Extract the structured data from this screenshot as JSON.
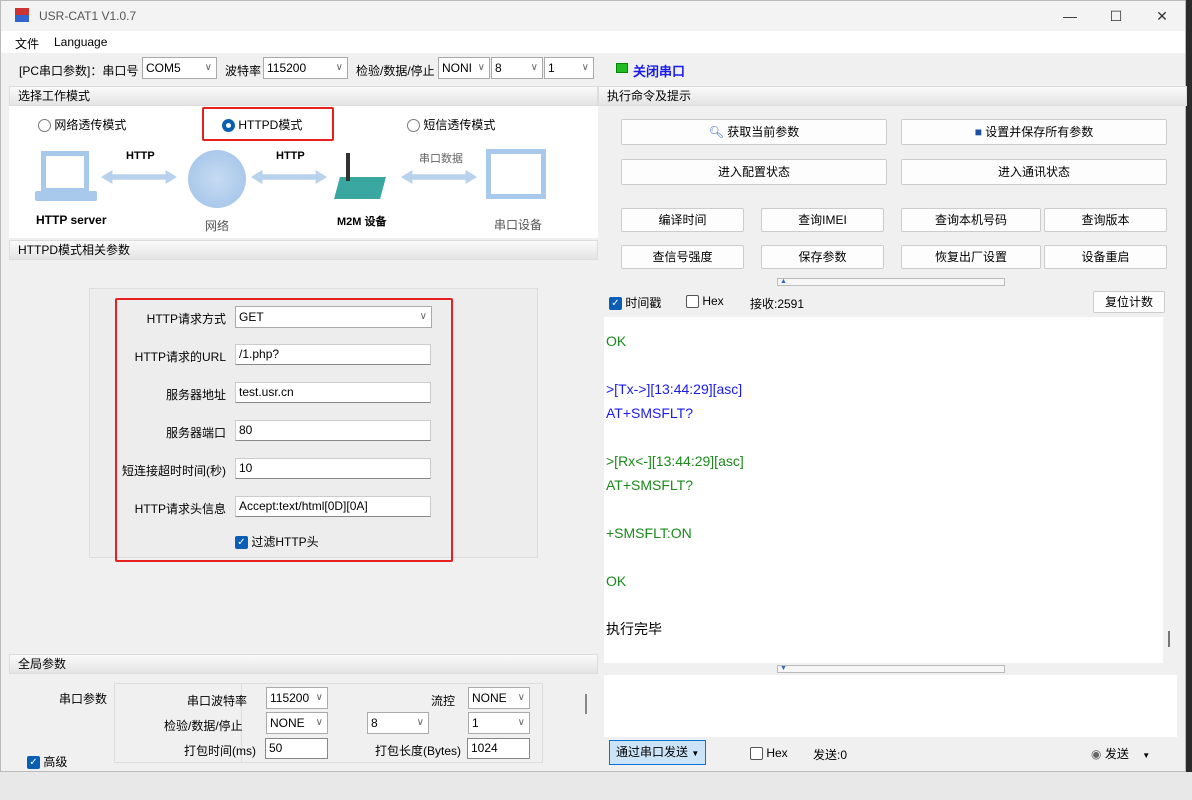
{
  "window": {
    "title": "USR-CAT1 V1.0.7",
    "min": "—",
    "max": "☐",
    "close": "✕"
  },
  "menu": [
    "文件",
    "Language"
  ],
  "toolbar": {
    "label": "[PC串口参数]：串口号",
    "port": "COM5",
    "baud_label": "波特率",
    "baud": "115200",
    "parity_label": "检验/数据/停止",
    "parity": "NONI",
    "data": "8",
    "stop": "1",
    "close_port": "关闭串口",
    "status_color": "#22bb22"
  },
  "mode": {
    "header": "选择工作模式",
    "options": [
      "网络透传模式",
      "HTTPD模式",
      "短信透传模式"
    ],
    "selected": 1,
    "diagram": {
      "http1": "HTTP",
      "http2": "HTTP",
      "serial_data": "串口数据",
      "server": "HTTP server",
      "network": "网络",
      "m2m": "M2M 设备",
      "serial_device": "串口设备"
    }
  },
  "httpd": {
    "header": "HTTPD模式相关参数",
    "fields": [
      {
        "label": "HTTP请求方式",
        "value": "GET",
        "type": "select"
      },
      {
        "label": "HTTP请求的URL",
        "value": "/1.php?"
      },
      {
        "label": "服务器地址",
        "value": "test.usr.cn"
      },
      {
        "label": "服务器端口",
        "value": "80"
      },
      {
        "label": "短连接超时时间(秒)",
        "value": "10"
      },
      {
        "label": "HTTP请求头信息",
        "value": "Accept:text/html[0D][0A]"
      }
    ],
    "filter_label": "过滤HTTP头",
    "filter_checked": true
  },
  "global": {
    "header": "全局参数",
    "serial_label": "串口参数",
    "baud_label": "串口波特率",
    "baud": "115200",
    "flow_label": "流控",
    "flow": "NONE",
    "parity_label": "检验/数据/停止",
    "parity": "NONE",
    "data": "8",
    "stop": "1",
    "pack_time_label": "打包时间(ms)",
    "pack_time": "50",
    "pack_len_label": "打包长度(Bytes)",
    "pack_len": "1024",
    "advanced_label": "高级",
    "advanced_checked": true
  },
  "commands": {
    "header": "执行命令及提示",
    "get_params": "获取当前参数",
    "save_all": "设置并保存所有参数",
    "enter_config": "进入配置状态",
    "enter_comm": "进入通讯状态",
    "grid": [
      "编译时间",
      "查询IMEI",
      "查询本机号码",
      "查询版本",
      "查信号强度",
      "保存参数",
      "恢复出厂设置",
      "设备重启"
    ]
  },
  "receive": {
    "timestamp_label": "时间戳",
    "timestamp_checked": true,
    "hex_label": "Hex",
    "count": "接收:2591",
    "reset": "复位计数",
    "log": [
      {
        "t": "OK",
        "c": "#1a8a1a"
      },
      {
        "t": "",
        "c": "#000"
      },
      {
        "t": ">[Tx->][13:44:29][asc]",
        "c": "#1a1aee"
      },
      {
        "t": "AT+SMSFLT?",
        "c": "#1a1aee"
      },
      {
        "t": "",
        "c": "#000"
      },
      {
        "t": ">[Rx<-][13:44:29][asc]",
        "c": "#1a8a1a"
      },
      {
        "t": "AT+SMSFLT?",
        "c": "#1a8a1a"
      },
      {
        "t": "",
        "c": "#000"
      },
      {
        "t": "+SMSFLT:ON",
        "c": "#1a8a1a"
      },
      {
        "t": "",
        "c": "#000"
      },
      {
        "t": "OK",
        "c": "#1a8a1a"
      },
      {
        "t": "",
        "c": "#000"
      },
      {
        "t": "执行完毕",
        "c": "#000"
      }
    ]
  },
  "send": {
    "via": "通过串口发送",
    "hex_label": "Hex",
    "count": "发送:0",
    "send": "发送"
  }
}
